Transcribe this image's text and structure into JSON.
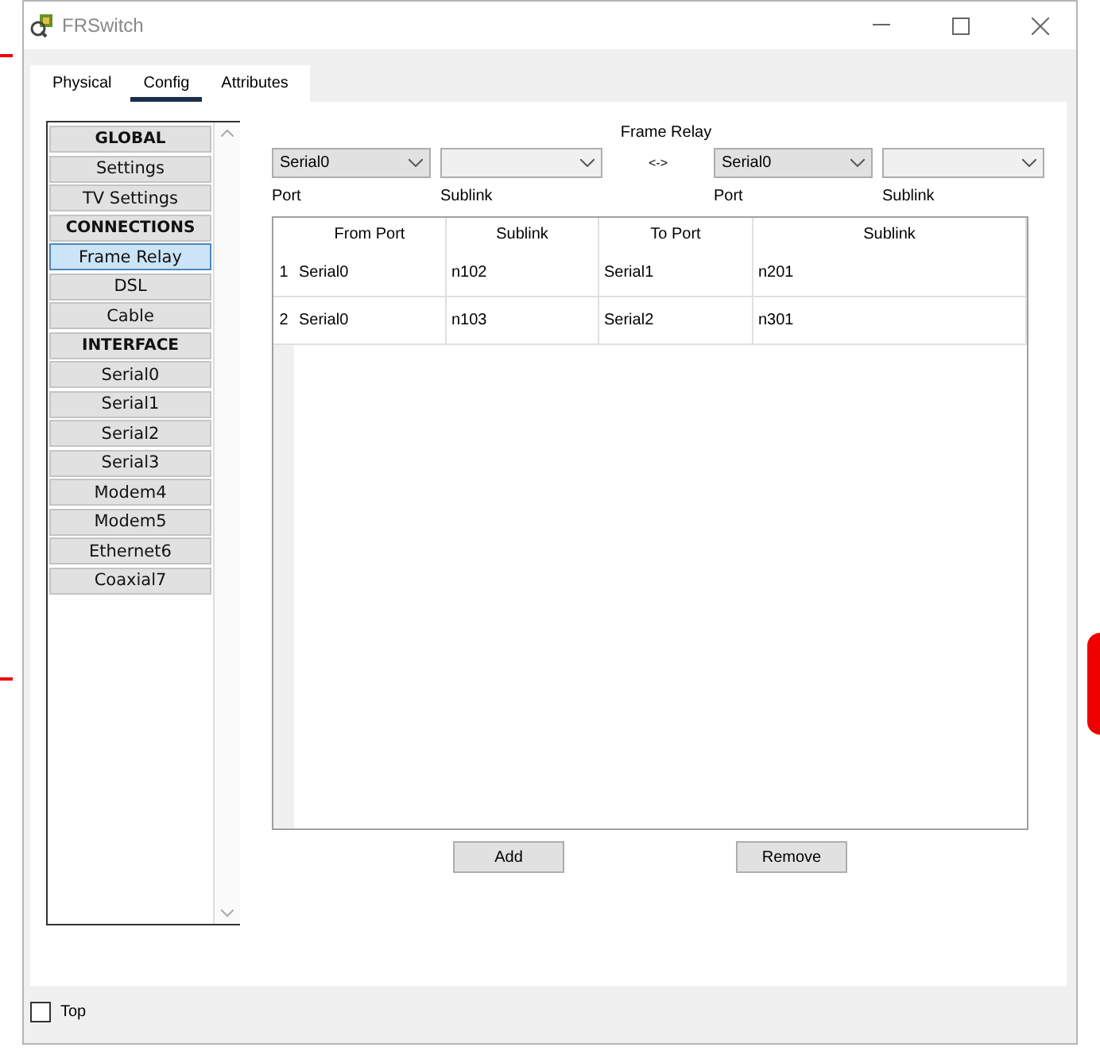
{
  "window": {
    "title": "FRSwitch"
  },
  "tabs": [
    {
      "label": "Physical",
      "selected": false
    },
    {
      "label": "Config",
      "selected": true
    },
    {
      "label": "Attributes",
      "selected": false
    }
  ],
  "sidebar": {
    "items": [
      {
        "kind": "header",
        "label": "GLOBAL",
        "selected": false
      },
      {
        "kind": "item",
        "label": "Settings",
        "selected": false
      },
      {
        "kind": "item",
        "label": "TV Settings",
        "selected": false
      },
      {
        "kind": "header",
        "label": "CONNECTIONS",
        "selected": false
      },
      {
        "kind": "item",
        "label": "Frame Relay",
        "selected": true
      },
      {
        "kind": "item",
        "label": "DSL",
        "selected": false
      },
      {
        "kind": "item",
        "label": "Cable",
        "selected": false
      },
      {
        "kind": "header",
        "label": "INTERFACE",
        "selected": false
      },
      {
        "kind": "item",
        "label": "Serial0",
        "selected": false
      },
      {
        "kind": "item",
        "label": "Serial1",
        "selected": false
      },
      {
        "kind": "item",
        "label": "Serial2",
        "selected": false
      },
      {
        "kind": "item",
        "label": "Serial3",
        "selected": false
      },
      {
        "kind": "item",
        "label": "Modem4",
        "selected": false
      },
      {
        "kind": "item",
        "label": "Modem5",
        "selected": false
      },
      {
        "kind": "item",
        "label": "Ethernet6",
        "selected": false
      },
      {
        "kind": "item",
        "label": "Coaxial7",
        "selected": false
      }
    ]
  },
  "frame_relay": {
    "title": "Frame Relay",
    "separator": "<->",
    "selectors": [
      {
        "value": "Serial0",
        "label": "Port"
      },
      {
        "label": "Sublink"
      },
      {
        "value": "Serial0",
        "label": "Port"
      },
      {
        "label": "Sublink"
      }
    ],
    "table": {
      "columns": [
        "From Port",
        "Sublink",
        "To Port",
        "Sublink"
      ],
      "rows": [
        {
          "number": "1",
          "cells": [
            "Serial0",
            "n102",
            "Serial1",
            "n201"
          ]
        },
        {
          "number": "2",
          "cells": [
            "Serial0",
            "n103",
            "Serial2",
            "n301"
          ]
        }
      ]
    },
    "buttons": [
      "Add",
      "Remove"
    ]
  },
  "top_checkbox": {
    "label": "Top",
    "checked": false
  }
}
